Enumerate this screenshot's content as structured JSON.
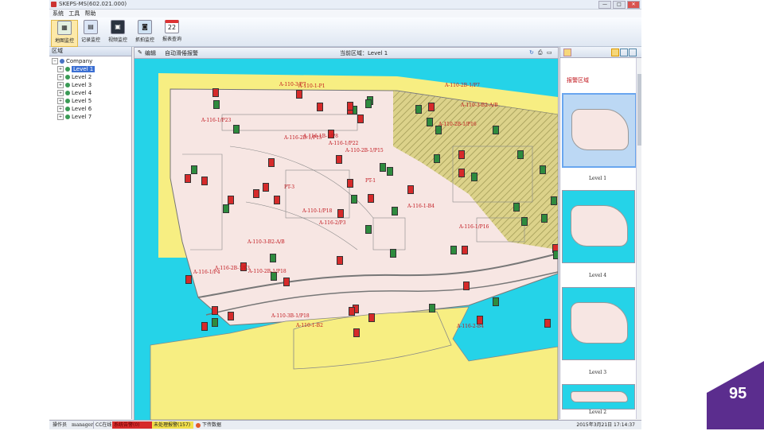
{
  "window": {
    "title": "SKEPS-MS(602.021.000)",
    "buttons": [
      "—",
      "□",
      "✕"
    ]
  },
  "menu": [
    "系统",
    "工具",
    "帮助"
  ],
  "toolbar": [
    {
      "label": "地图监控",
      "icon": "map-icon",
      "active": true
    },
    {
      "label": "记录监控",
      "icon": "record-icon",
      "active": false
    },
    {
      "label": "视频监控",
      "icon": "video-icon",
      "active": false
    },
    {
      "label": "抓拍监控",
      "icon": "camera-icon",
      "active": false
    },
    {
      "label": "报表查询",
      "icon": "calendar-icon",
      "active": false,
      "calendar_day": "22"
    }
  ],
  "left_panel": {
    "header": "区域",
    "root": "Company",
    "levels": [
      "Level 1",
      "Level 2",
      "Level 3",
      "Level 4",
      "Level 5",
      "Level 6",
      "Level 7"
    ],
    "selected_index": 0
  },
  "center": {
    "edit_label": "编辑",
    "auto_alarm_label": "自动滑倦报警",
    "current_area": "当前区域：Level 1"
  },
  "map_labels": [
    "A-110-2B-1/P18",
    "A-110-3B-1/P18",
    "PT-1",
    "A-110-2B-1/P16",
    "PT-3",
    "A-116-1/P16",
    "A-116-1/P23",
    "A-116-1/P22",
    "A-110-1/P18",
    "A-110-3/P7",
    "A-116-1/P4",
    "A-116-2/P3",
    "A-110-3-B2-A/B",
    "A-116-1B-1/P8",
    "A-110-1-P1",
    "A-116-2B-1/P3",
    "A-110-2B-1/P7",
    "A-110-2B-1/P15",
    "A-116-2B-1/P15",
    "A-116-1-B4",
    "A-110-3-B2-A/B",
    "A-116-2-B4",
    "A-110-1-B2"
  ],
  "right_panel": {
    "header": "报警区域",
    "thumbnails": [
      "Level 1",
      "Level 4",
      "Level 3",
      "Level 2"
    ],
    "selected_index": 0
  },
  "statusbar": {
    "operator_label": "操作员",
    "operator_name": "manager",
    "cc_status": "CC在线",
    "alarm_confirm": "系统告警(0)",
    "unhandled": "未处理报警(157)",
    "download": "下传数据",
    "datetime": "2015年3月21日 17:14:37"
  },
  "slide_number": "95",
  "colors": {
    "map_water": "#25d3e8",
    "land": "#f7e6e3",
    "sand": "#f7ee82",
    "hatch": "#b7b04a",
    "device_green": "#2e8b3e",
    "device_red": "#d62a2a",
    "label_red": "#c0141b",
    "badge": "#5b2d8e"
  }
}
